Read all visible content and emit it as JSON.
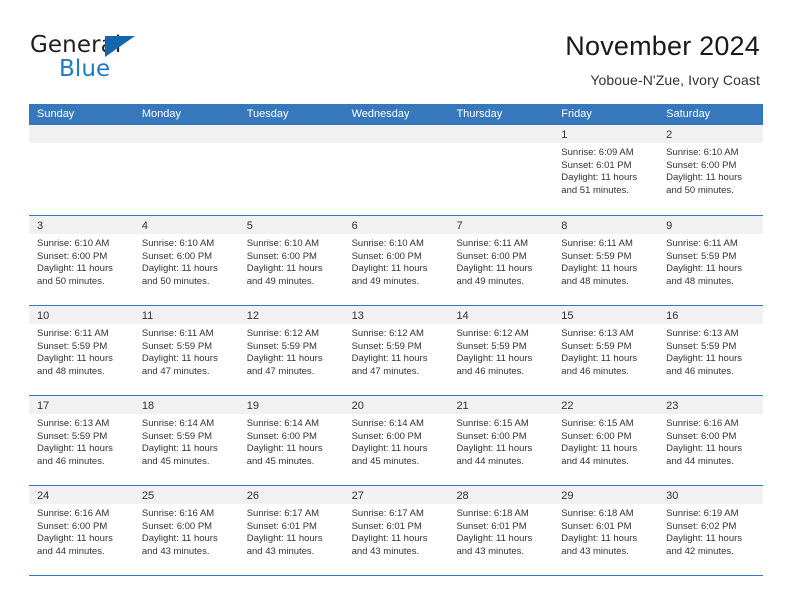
{
  "brand": {
    "word_one": "General",
    "word_two": "Blue",
    "triangle_icon": "triangle-icon",
    "accent_color": "#1466ad",
    "blue_text_color": "#1f7ac4"
  },
  "header": {
    "title": "November 2024",
    "subtitle": "Yoboue-N'Zue, Ivory Coast"
  },
  "calendar": {
    "header_bg": "#3777bc",
    "day_strip_bg": "#f1f1f1",
    "weekdays": [
      "Sunday",
      "Monday",
      "Tuesday",
      "Wednesday",
      "Thursday",
      "Friday",
      "Saturday"
    ],
    "weeks": [
      [
        {
          "day": "",
          "sunrise": "",
          "sunset": "",
          "daylight": "",
          "empty": true
        },
        {
          "day": "",
          "sunrise": "",
          "sunset": "",
          "daylight": "",
          "empty": true
        },
        {
          "day": "",
          "sunrise": "",
          "sunset": "",
          "daylight": "",
          "empty": true
        },
        {
          "day": "",
          "sunrise": "",
          "sunset": "",
          "daylight": "",
          "empty": true
        },
        {
          "day": "",
          "sunrise": "",
          "sunset": "",
          "daylight": "",
          "empty": true
        },
        {
          "day": "1",
          "sunrise": "Sunrise: 6:09 AM",
          "sunset": "Sunset: 6:01 PM",
          "daylight": "Daylight: 11 hours and 51 minutes.",
          "empty": false
        },
        {
          "day": "2",
          "sunrise": "Sunrise: 6:10 AM",
          "sunset": "Sunset: 6:00 PM",
          "daylight": "Daylight: 11 hours and 50 minutes.",
          "empty": false
        }
      ],
      [
        {
          "day": "3",
          "sunrise": "Sunrise: 6:10 AM",
          "sunset": "Sunset: 6:00 PM",
          "daylight": "Daylight: 11 hours and 50 minutes.",
          "empty": false
        },
        {
          "day": "4",
          "sunrise": "Sunrise: 6:10 AM",
          "sunset": "Sunset: 6:00 PM",
          "daylight": "Daylight: 11 hours and 50 minutes.",
          "empty": false
        },
        {
          "day": "5",
          "sunrise": "Sunrise: 6:10 AM",
          "sunset": "Sunset: 6:00 PM",
          "daylight": "Daylight: 11 hours and 49 minutes.",
          "empty": false
        },
        {
          "day": "6",
          "sunrise": "Sunrise: 6:10 AM",
          "sunset": "Sunset: 6:00 PM",
          "daylight": "Daylight: 11 hours and 49 minutes.",
          "empty": false
        },
        {
          "day": "7",
          "sunrise": "Sunrise: 6:11 AM",
          "sunset": "Sunset: 6:00 PM",
          "daylight": "Daylight: 11 hours and 49 minutes.",
          "empty": false
        },
        {
          "day": "8",
          "sunrise": "Sunrise: 6:11 AM",
          "sunset": "Sunset: 5:59 PM",
          "daylight": "Daylight: 11 hours and 48 minutes.",
          "empty": false
        },
        {
          "day": "9",
          "sunrise": "Sunrise: 6:11 AM",
          "sunset": "Sunset: 5:59 PM",
          "daylight": "Daylight: 11 hours and 48 minutes.",
          "empty": false
        }
      ],
      [
        {
          "day": "10",
          "sunrise": "Sunrise: 6:11 AM",
          "sunset": "Sunset: 5:59 PM",
          "daylight": "Daylight: 11 hours and 48 minutes.",
          "empty": false
        },
        {
          "day": "11",
          "sunrise": "Sunrise: 6:11 AM",
          "sunset": "Sunset: 5:59 PM",
          "daylight": "Daylight: 11 hours and 47 minutes.",
          "empty": false
        },
        {
          "day": "12",
          "sunrise": "Sunrise: 6:12 AM",
          "sunset": "Sunset: 5:59 PM",
          "daylight": "Daylight: 11 hours and 47 minutes.",
          "empty": false
        },
        {
          "day": "13",
          "sunrise": "Sunrise: 6:12 AM",
          "sunset": "Sunset: 5:59 PM",
          "daylight": "Daylight: 11 hours and 47 minutes.",
          "empty": false
        },
        {
          "day": "14",
          "sunrise": "Sunrise: 6:12 AM",
          "sunset": "Sunset: 5:59 PM",
          "daylight": "Daylight: 11 hours and 46 minutes.",
          "empty": false
        },
        {
          "day": "15",
          "sunrise": "Sunrise: 6:13 AM",
          "sunset": "Sunset: 5:59 PM",
          "daylight": "Daylight: 11 hours and 46 minutes.",
          "empty": false
        },
        {
          "day": "16",
          "sunrise": "Sunrise: 6:13 AM",
          "sunset": "Sunset: 5:59 PM",
          "daylight": "Daylight: 11 hours and 46 minutes.",
          "empty": false
        }
      ],
      [
        {
          "day": "17",
          "sunrise": "Sunrise: 6:13 AM",
          "sunset": "Sunset: 5:59 PM",
          "daylight": "Daylight: 11 hours and 46 minutes.",
          "empty": false
        },
        {
          "day": "18",
          "sunrise": "Sunrise: 6:14 AM",
          "sunset": "Sunset: 5:59 PM",
          "daylight": "Daylight: 11 hours and 45 minutes.",
          "empty": false
        },
        {
          "day": "19",
          "sunrise": "Sunrise: 6:14 AM",
          "sunset": "Sunset: 6:00 PM",
          "daylight": "Daylight: 11 hours and 45 minutes.",
          "empty": false
        },
        {
          "day": "20",
          "sunrise": "Sunrise: 6:14 AM",
          "sunset": "Sunset: 6:00 PM",
          "daylight": "Daylight: 11 hours and 45 minutes.",
          "empty": false
        },
        {
          "day": "21",
          "sunrise": "Sunrise: 6:15 AM",
          "sunset": "Sunset: 6:00 PM",
          "daylight": "Daylight: 11 hours and 44 minutes.",
          "empty": false
        },
        {
          "day": "22",
          "sunrise": "Sunrise: 6:15 AM",
          "sunset": "Sunset: 6:00 PM",
          "daylight": "Daylight: 11 hours and 44 minutes.",
          "empty": false
        },
        {
          "day": "23",
          "sunrise": "Sunrise: 6:16 AM",
          "sunset": "Sunset: 6:00 PM",
          "daylight": "Daylight: 11 hours and 44 minutes.",
          "empty": false
        }
      ],
      [
        {
          "day": "24",
          "sunrise": "Sunrise: 6:16 AM",
          "sunset": "Sunset: 6:00 PM",
          "daylight": "Daylight: 11 hours and 44 minutes.",
          "empty": false
        },
        {
          "day": "25",
          "sunrise": "Sunrise: 6:16 AM",
          "sunset": "Sunset: 6:00 PM",
          "daylight": "Daylight: 11 hours and 43 minutes.",
          "empty": false
        },
        {
          "day": "26",
          "sunrise": "Sunrise: 6:17 AM",
          "sunset": "Sunset: 6:01 PM",
          "daylight": "Daylight: 11 hours and 43 minutes.",
          "empty": false
        },
        {
          "day": "27",
          "sunrise": "Sunrise: 6:17 AM",
          "sunset": "Sunset: 6:01 PM",
          "daylight": "Daylight: 11 hours and 43 minutes.",
          "empty": false
        },
        {
          "day": "28",
          "sunrise": "Sunrise: 6:18 AM",
          "sunset": "Sunset: 6:01 PM",
          "daylight": "Daylight: 11 hours and 43 minutes.",
          "empty": false
        },
        {
          "day": "29",
          "sunrise": "Sunrise: 6:18 AM",
          "sunset": "Sunset: 6:01 PM",
          "daylight": "Daylight: 11 hours and 43 minutes.",
          "empty": false
        },
        {
          "day": "30",
          "sunrise": "Sunrise: 6:19 AM",
          "sunset": "Sunset: 6:02 PM",
          "daylight": "Daylight: 11 hours and 42 minutes.",
          "empty": false
        }
      ]
    ]
  }
}
